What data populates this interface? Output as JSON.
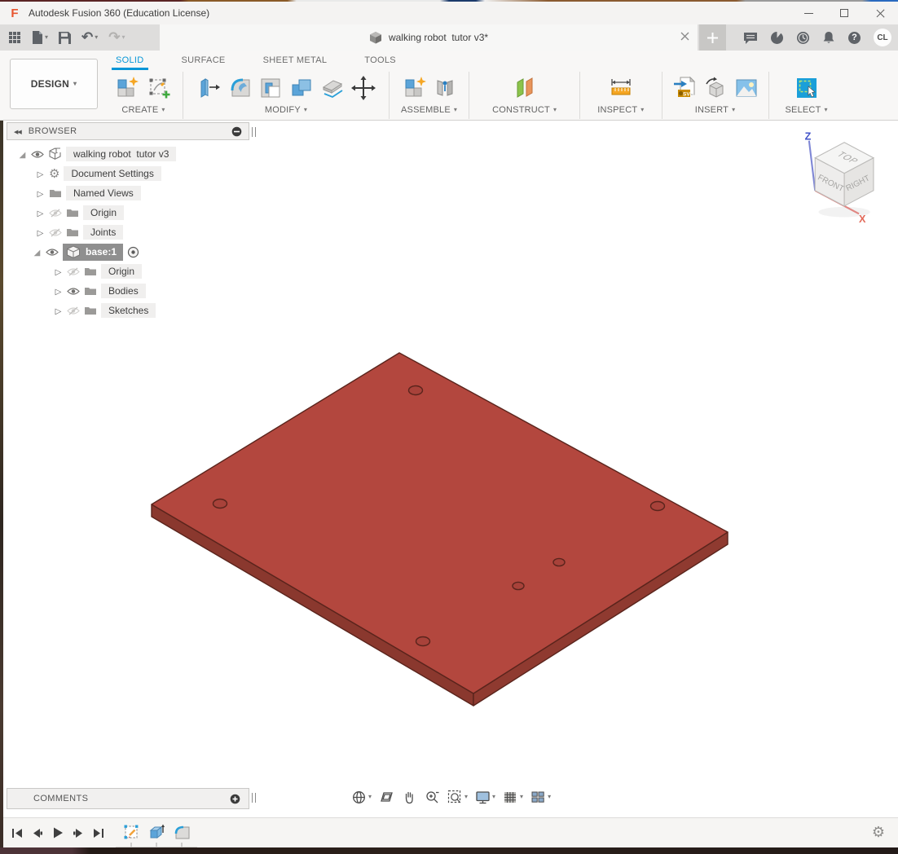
{
  "window": {
    "title": "Autodesk Fusion 360 (Education License)"
  },
  "appbar": {
    "tab": {
      "title": "walking robot  tutor v3*"
    },
    "avatar_initials": "CL",
    "help_glyph": "?"
  },
  "workspace_selector": {
    "label": "DESIGN"
  },
  "ribbon": {
    "tabs": {
      "solid": "SOLID",
      "surface": "SURFACE",
      "sheet_metal": "SHEET METAL",
      "tools": "TOOLS"
    },
    "groups": {
      "create": "CREATE",
      "modify": "MODIFY",
      "assemble": "ASSEMBLE",
      "construct": "CONSTRUCT",
      "inspect": "INSPECT",
      "insert": "INSERT",
      "select": "SELECT"
    },
    "icon_labels": {
      "svg_badge": "SVG"
    }
  },
  "browser": {
    "title": "BROWSER",
    "items": [
      {
        "label": "walking robot  tutor v3",
        "type": "component-root",
        "expanded": true,
        "visible": true
      },
      {
        "label": "Document Settings",
        "type": "settings"
      },
      {
        "label": "Named Views",
        "type": "folder"
      },
      {
        "label": "Origin",
        "type": "folder",
        "hidden": true
      },
      {
        "label": "Joints",
        "type": "folder",
        "hidden": true
      },
      {
        "label": "base:1",
        "type": "component",
        "expanded": true,
        "visible": true,
        "selected": true,
        "activated": true
      },
      {
        "label": "Origin",
        "type": "folder",
        "hidden": true
      },
      {
        "label": "Bodies",
        "type": "folder",
        "visible": true
      },
      {
        "label": "Sketches",
        "type": "folder",
        "hidden": true
      }
    ]
  },
  "viewcube": {
    "top": "TOP",
    "front": "FRONT",
    "right": "RIGHT",
    "axis_z": "Z",
    "axis_x": "X"
  },
  "comments": {
    "label": "COMMENTS"
  },
  "colors": {
    "accent_blue": "#0696d7",
    "plate_top": "#b3473e",
    "plate_side_left": "#8a382e",
    "plate_side_right": "#8f3a30",
    "axis_z_blue": "#4253c9",
    "axis_x_red": "#e26a5a"
  }
}
